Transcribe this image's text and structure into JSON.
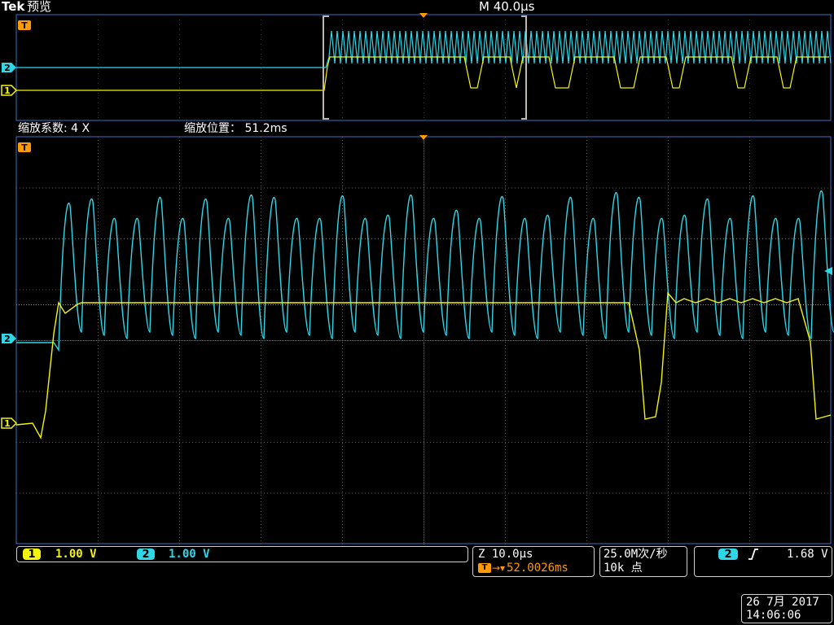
{
  "header": {
    "brand": "Tek",
    "mode": "预览",
    "timebase": "M 40.0µs"
  },
  "zoom": {
    "factor_label": "缩放系数: 4 X",
    "position_label": "缩放位置： 51.2ms"
  },
  "markers": {
    "trigger": "T",
    "ch1": "1",
    "ch2": "2"
  },
  "channels": [
    {
      "id": "1",
      "scale": "1.00 V",
      "color": "#f4f40a"
    },
    {
      "id": "2",
      "scale": "1.00 V",
      "color": "#2fd6e6"
    }
  ],
  "horizontal": {
    "zoom_scale": "Z 10.0µs",
    "trigger_position": "52.0026ms"
  },
  "acquisition": {
    "sample_rate": "25.0M次/秒",
    "record_length": "10k 点"
  },
  "trigger": {
    "source": "2",
    "slope_icon": "rising-edge-icon",
    "level": "1.68 V"
  },
  "datetime": {
    "date": "26 7月  2017",
    "time": "14:06:06"
  },
  "colors": {
    "ch1": "#f4f40a",
    "ch2": "#2fd6e6",
    "accent": "#ff9a00",
    "frame": "#3a6fc4"
  }
}
